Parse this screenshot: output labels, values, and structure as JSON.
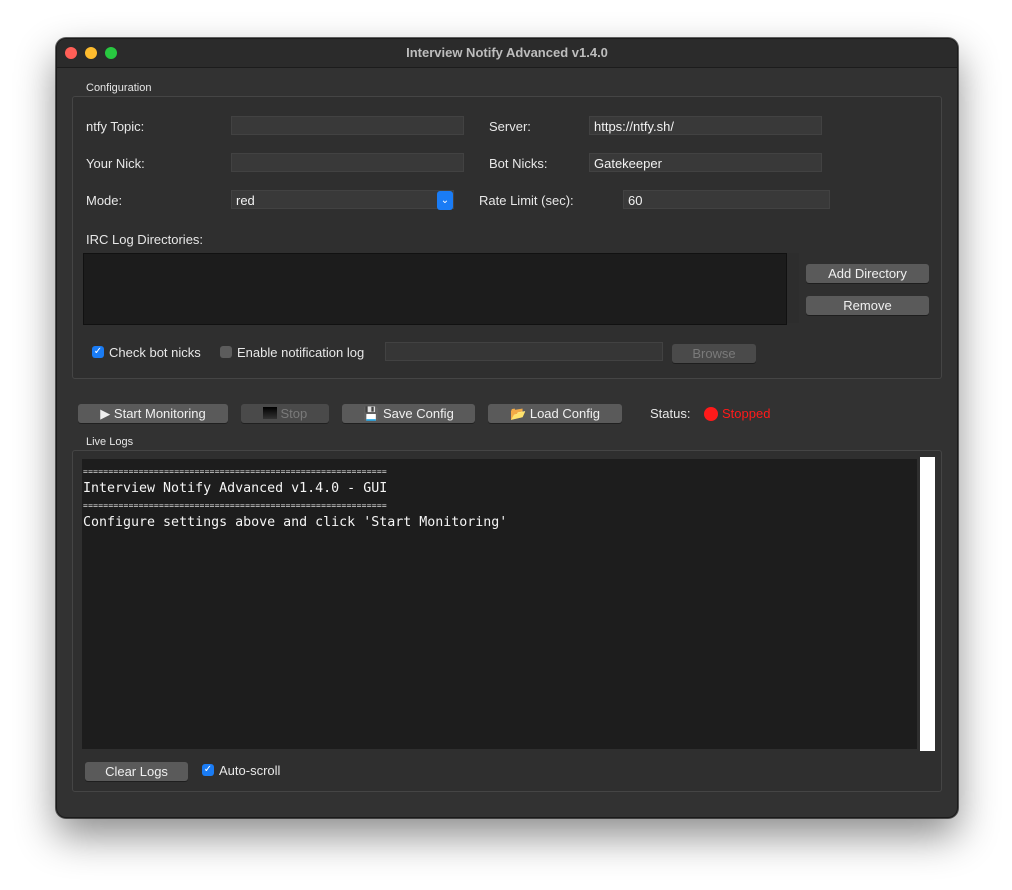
{
  "window": {
    "title": "Interview Notify Advanced v1.4.0"
  },
  "config": {
    "group_label": "Configuration",
    "ntfy_topic_label": "ntfy Topic:",
    "ntfy_topic_value": "",
    "server_label": "Server:",
    "server_value": "https://ntfy.sh/",
    "nick_label": "Your Nick:",
    "nick_value": "",
    "bot_nicks_label": "Bot Nicks:",
    "bot_nicks_value": "Gatekeeper",
    "mode_label": "Mode:",
    "mode_value": "red",
    "rate_limit_label": "Rate Limit (sec):",
    "rate_limit_value": "60",
    "irc_dirs_label": "IRC Log Directories:",
    "add_directory": "Add Directory",
    "remove": "Remove",
    "check_bot_nicks": "Check bot nicks",
    "check_bot_nicks_checked": true,
    "enable_notification_log": "Enable notification log",
    "enable_notification_log_checked": false,
    "notification_log_path": "",
    "browse": "Browse"
  },
  "toolbar": {
    "start": "Start Monitoring",
    "stop": "Stop",
    "save": "Save Config",
    "load": "Load Config",
    "status_label": "Status:",
    "status_value": "Stopped",
    "status_color": "#ff1a1a"
  },
  "logs": {
    "group_label": "Live Logs",
    "lines": [
      "============================================================",
      "Interview Notify Advanced v1.4.0 - GUI",
      "============================================================",
      "Configure settings above and click 'Start Monitoring'"
    ],
    "clear_logs": "Clear Logs",
    "auto_scroll": "Auto-scroll",
    "auto_scroll_checked": true
  },
  "icons": {
    "start": "play-icon",
    "stop": "stop-icon",
    "save": "floppy-disk-icon",
    "load": "folder-icon"
  }
}
